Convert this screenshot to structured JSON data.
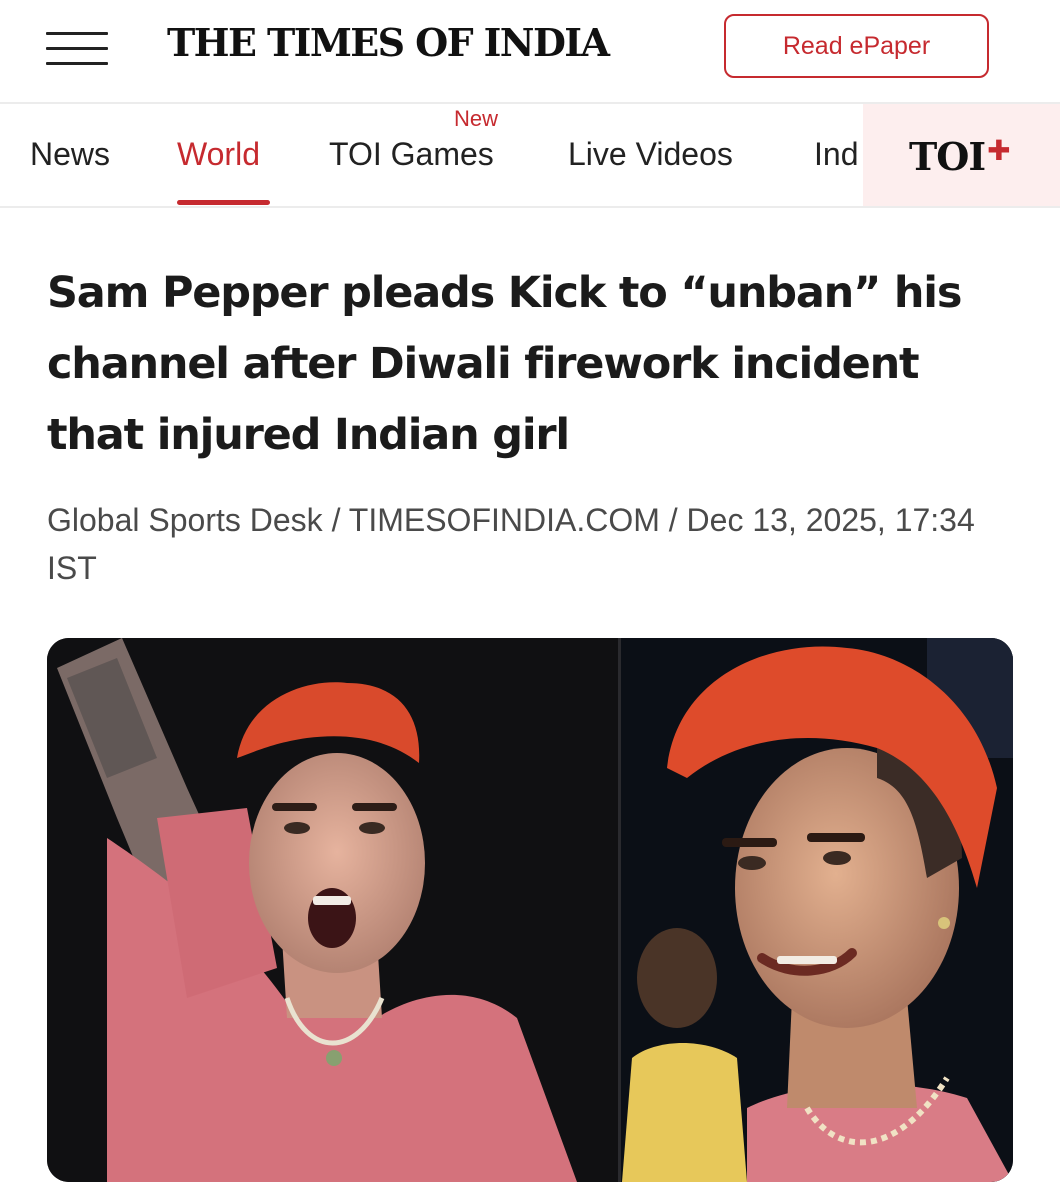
{
  "header": {
    "menu_icon": "hamburger-menu-icon",
    "logo_text": "THE TIMES OF INDIA",
    "epaper_label": "Read ePaper",
    "accent_color": "#c62a2f"
  },
  "nav": {
    "items": [
      {
        "label": "News",
        "active": false
      },
      {
        "label": "World",
        "active": true
      },
      {
        "label": "TOI Games",
        "active": false,
        "badge": "New"
      },
      {
        "label": "Live Videos",
        "active": false
      },
      {
        "label": "Ind",
        "active": false
      }
    ],
    "toi_plus": {
      "text": "TOI",
      "plus": "✚"
    }
  },
  "article": {
    "headline": "Sam Pepper pleads Kick to “unban” his channel after Diwali firework incident that injured Indian girl",
    "byline": "Global Sports Desk / TIMESOFINDIA.COM / Dec 13, 2025, 17:34 IST"
  }
}
